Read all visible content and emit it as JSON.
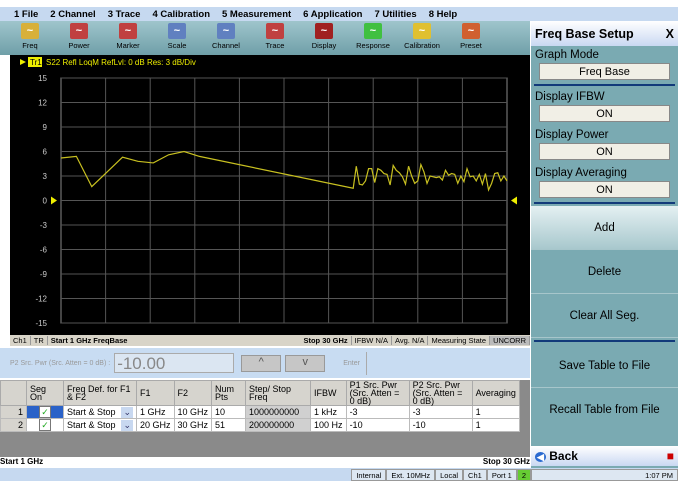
{
  "menu": [
    "1 File",
    "2 Channel",
    "3 Trace",
    "4 Calibration",
    "5 Measurement",
    "6 Application",
    "7 Utilities",
    "8 Help"
  ],
  "toolbar": [
    {
      "label": "Freq",
      "icon": "freq-icon",
      "color": "#d8b03a"
    },
    {
      "label": "Power",
      "icon": "power-icon",
      "color": "#c04040"
    },
    {
      "label": "Marker",
      "icon": "marker-icon",
      "color": "#c04040"
    },
    {
      "label": "Scale",
      "icon": "scale-icon",
      "color": "#6080c0"
    },
    {
      "label": "Channel",
      "icon": "channel-icon",
      "color": "#6080c0"
    },
    {
      "label": "Trace",
      "icon": "trace-icon",
      "color": "#c04040"
    },
    {
      "label": "Display",
      "icon": "display-icon",
      "color": "#a02020"
    },
    {
      "label": "Response",
      "icon": "response-icon",
      "color": "#40c040"
    },
    {
      "label": "Calibration",
      "icon": "wrench-icon",
      "color": "#e0c030"
    },
    {
      "label": "Preset",
      "icon": "home-icon",
      "color": "#d06030"
    }
  ],
  "chart_data": {
    "type": "line",
    "title": "S22 Refl LoqM RefLvl: 0  dB Res: 3  dB/Div",
    "trace_label": "Tr1",
    "ylim": [
      -15,
      15
    ],
    "yticks": [
      15,
      12,
      9,
      6,
      3,
      0,
      -3,
      -6,
      -9,
      -12,
      -15
    ],
    "xlim": [
      1,
      30
    ],
    "xunit": "GHz",
    "ref_level": 0,
    "color": "#c8c020",
    "series": [
      {
        "name": "Tr1",
        "x": [
          1,
          2,
          3,
          4,
          5,
          6,
          7,
          8,
          9,
          10
        ],
        "y": [
          5.2,
          5.4,
          1.7,
          3.5,
          5.3,
          4.8,
          4.6,
          5.6,
          6.0,
          5.4
        ]
      },
      {
        "name": "Tr1-seg2",
        "x0": 20,
        "step": 0.2,
        "y": [
          1.5,
          4.2,
          2.0,
          1.9,
          2.4,
          3.9,
          3.9,
          2.2,
          3.9,
          3.7,
          3.3,
          3.2,
          1.9,
          4.3,
          3.7,
          3.4,
          2.9,
          2.0,
          4.2,
          3.0,
          2.1,
          2.4,
          4.4,
          3.5,
          2.1,
          3.0,
          2.9,
          2.8,
          2.9,
          2.5,
          3.7,
          3.1,
          3.3,
          3.2,
          2.1,
          3.0,
          2.3,
          3.9,
          2.9,
          3.0,
          2.4,
          3.2,
          2.0,
          3.3,
          1.3,
          2.1,
          3.3,
          3.4,
          2.4,
          3.0,
          2.4
        ]
      }
    ]
  },
  "chstatus": {
    "ch": "Ch1",
    "tr": "TR",
    "start": "Start 1 GHz  FreqBase",
    "stop": "Stop 30 GHz",
    "ifbw": "IFBW N/A",
    "avg": "Avg. N/A",
    "state": "Measuring State",
    "cal": "UNCORR"
  },
  "power": {
    "label": "P2 Src. Pwr  (Src. Atten = 0 dB)  :",
    "value": "-10.00",
    "up": "^",
    "down": "v",
    "enter": "Enter"
  },
  "table": {
    "headers": [
      "",
      "Seg On",
      "Freq Def. for F1 & F2",
      "F1",
      "F2",
      "Num Pts",
      "Step/ Stop Freq",
      "IFBW",
      "P1 Src. Pwr  (Src. Atten = 0 dB)",
      "P2 Src. Pwr  (Src. Atten = 0 dB)",
      "Averaging"
    ],
    "rows": [
      [
        "1",
        "✓",
        "Start & Stop",
        "1 GHz",
        "10 GHz",
        "10",
        "1000000000",
        "1 kHz",
        "-3",
        "-3",
        "1"
      ],
      [
        "2",
        "✓",
        "Start & Stop",
        "20 GHz",
        "30 GHz",
        "51",
        "200000000",
        "100 Hz",
        "-10",
        "-10",
        "1"
      ]
    ]
  },
  "footer": {
    "start": "Start 1 GHz",
    "stop": "Stop 30 GHz"
  },
  "statusbar": [
    "Internal",
    "Ext. 10MHz",
    "Local",
    "Ch1",
    "Port  1",
    "2",
    "1:07 PM"
  ],
  "panel": {
    "title": "Freq Base Setup",
    "close": "X",
    "graph_mode_label": "Graph Mode",
    "graph_mode": "Freq Base",
    "ifbw_label": "Display IFBW",
    "ifbw": "ON",
    "power_label": "Display Power",
    "power": "ON",
    "avg_label": "Display Averaging",
    "avg": "ON",
    "add": "Add",
    "delete": "Delete",
    "clear": "Clear All Seg.",
    "save": "Save Table to File",
    "recall": "Recall Table from File",
    "back": "Back"
  }
}
